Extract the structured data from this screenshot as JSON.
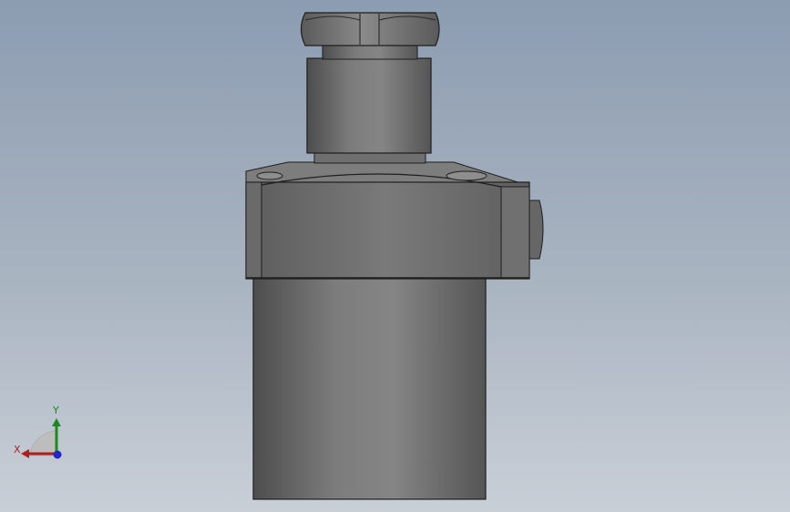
{
  "viewport": {
    "background_top": "#8c9cb1",
    "background_bottom": "#c9cfd7"
  },
  "model": {
    "body_color": "#6f6f6f",
    "edge_color": "#1e1e1e"
  },
  "triad": {
    "x_label": "X",
    "y_label": "Y",
    "x_color": "#b01e1e",
    "y_color": "#1e8a1e",
    "z_color": "#1e28c8"
  }
}
